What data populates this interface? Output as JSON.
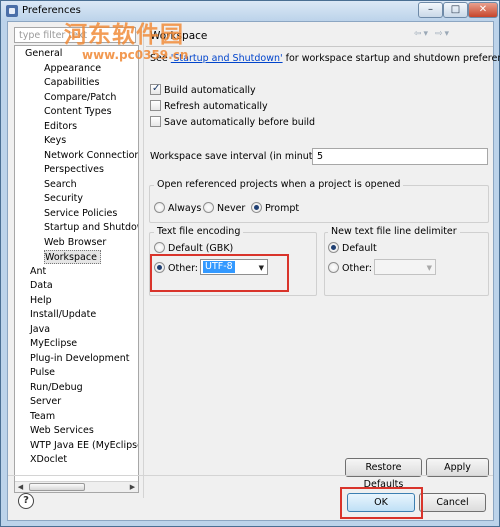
{
  "window": {
    "title": "Preferences",
    "controls": {
      "minimize": "–",
      "maximize": "□",
      "close": "✕"
    }
  },
  "filter": {
    "placeholder": "type filter text"
  },
  "tree": {
    "items": [
      "General",
      "Appearance",
      "Capabilities",
      "Compare/Patch",
      "Content Types",
      "Editors",
      "Keys",
      "Network Connections",
      "Perspectives",
      "Search",
      "Security",
      "Service Policies",
      "Startup and Shutdown",
      "Web Browser",
      "Workspace",
      "Ant",
      "Data",
      "Help",
      "Install/Update",
      "Java",
      "MyEclipse",
      "Plug-in Development",
      "Pulse",
      "Run/Debug",
      "Server",
      "Team",
      "Web Services",
      "WTP Java EE (MyEclipse)",
      "XDoclet"
    ],
    "selected": "Workspace"
  },
  "page": {
    "title": "Workspace",
    "nav_icons": [
      "back-icon",
      "dropdown-icon",
      "forward-icon",
      "dropdown-icon"
    ],
    "intro_prefix": "See",
    "intro_link": "'Startup and Shutdown'",
    "intro_suffix": "for workspace startup and shutdown preferences.",
    "build_automatically": {
      "label": "Build automatically",
      "checked": true
    },
    "refresh_automatically": {
      "label": "Refresh automatically",
      "checked": false
    },
    "save_before_build": {
      "label": "Save automatically before build",
      "checked": false
    },
    "save_interval": {
      "label": "Workspace save interval (in minutes):",
      "value": "5"
    },
    "open_projects": {
      "title": "Open referenced projects when a project is opened",
      "options": [
        "Always",
        "Never",
        "Prompt"
      ],
      "selected": "Prompt"
    },
    "encoding": {
      "title": "Text file encoding",
      "default_label": "Default (GBK)",
      "other_label": "Other:",
      "other_value": "UTF-8",
      "selected": "Other"
    },
    "line_delimiter": {
      "title": "New text file line delimiter",
      "default_label": "Default",
      "other_label": "Other:",
      "selected": "Default"
    },
    "restore_defaults": "Restore Defaults",
    "apply": "Apply"
  },
  "footer": {
    "help_glyph": "?",
    "ok": "OK",
    "cancel": "Cancel"
  },
  "watermark": {
    "text": "河东软件园",
    "url": "www.pc0359.cn"
  },
  "colors": {
    "highlight_box": "#d9342b",
    "link": "#0044cc",
    "selection": "#3399ff",
    "watermark": "#f08732"
  }
}
